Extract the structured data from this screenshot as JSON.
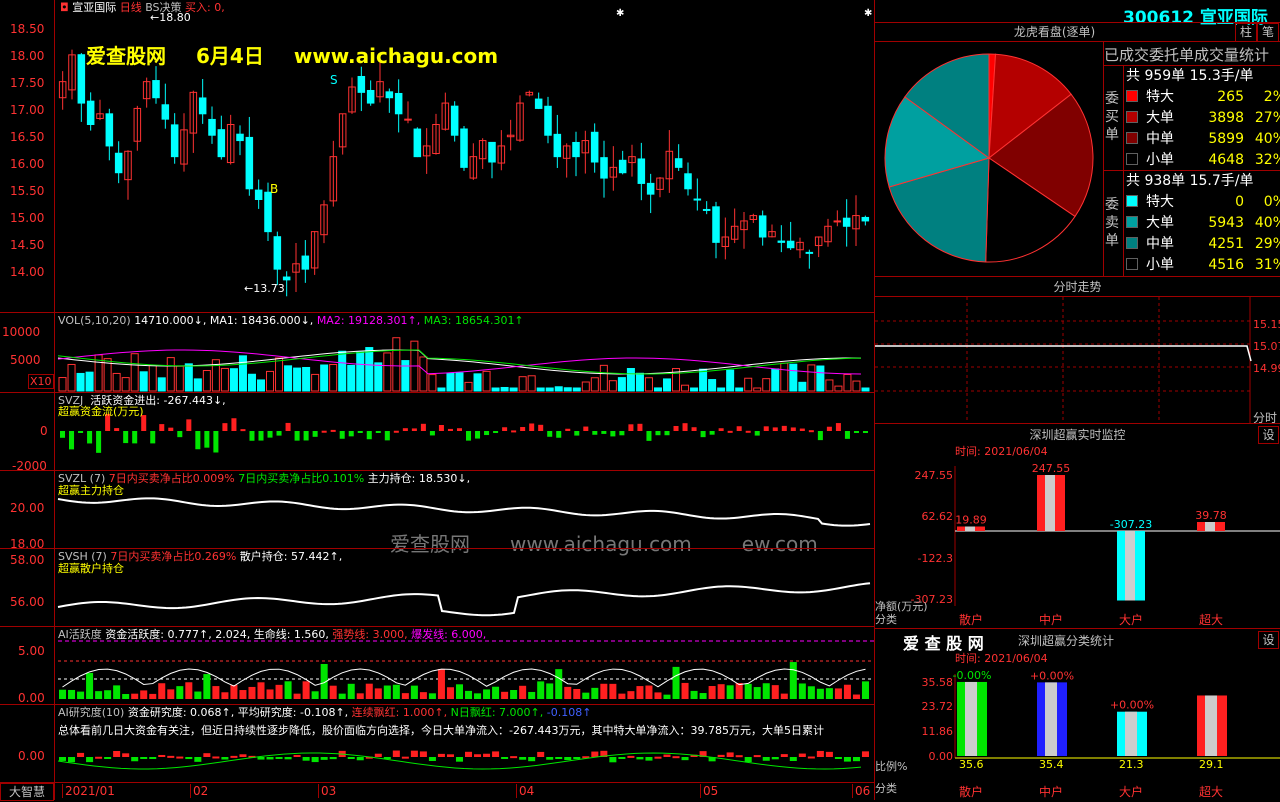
{
  "app": {
    "name": "大智慧",
    "brand_overlay": "爱查股网",
    "date_overlay": "6月4日",
    "url_overlay": "www.aichagu.com"
  },
  "main_chart": {
    "stock_name": "宣亚国际",
    "period": "日线",
    "strategy": "BS决策",
    "buy_text": "买入: 0,",
    "high_marker": "18.80",
    "low_marker": "13.73",
    "b_marker": "B",
    "s_marker": "S",
    "price_ticks": [
      "18.50",
      "18.00",
      "17.50",
      "17.00",
      "16.50",
      "16.00",
      "15.50",
      "15.00",
      "14.50",
      "14.00"
    ]
  },
  "vol_panel": {
    "label": "VOL(5,10,20)",
    "value": "14710.000↓,",
    "ma1": "MA1: 18436.000↓,",
    "ma2": "MA2: 19128.301↑,",
    "ma3": "MA3: 18654.301↑",
    "ticks": [
      "10000",
      "5000"
    ],
    "unit": "X10"
  },
  "svzj_panel": {
    "label": "SVZJ",
    "desc": "活跃资金进出: -267.443↓,",
    "sub": "超赢资金流(万元)",
    "ticks": [
      "0",
      "-2000"
    ]
  },
  "svzl_panel": {
    "label": "SVZL (7)",
    "a": "7日内买卖净占比0.009%",
    "b": "7日内买卖净占比0.101%",
    "c": "主力持仓: 18.530↓,",
    "sub": "超赢主力持仓",
    "ticks": [
      "20.00",
      "18.00"
    ],
    "watermark1": "爱查股网",
    "watermark2": "www.aichagu.com",
    "watermark3": "ew.com"
  },
  "svsh_panel": {
    "label": "SVSH (7)",
    "a": "7日内买卖净占比0.269%",
    "b": "散户持仓: 57.442↑,",
    "sub": "超赢散户持仓",
    "ticks": [
      "58.00",
      "56.00"
    ]
  },
  "ai_active": {
    "label": "AI活跃度",
    "a": "资金活跃度: 0.777↑,",
    "b": "2.024,",
    "c": "生命线: 1.560,",
    "d": "强势线: 3.000,",
    "e": "爆发线: 6.000,",
    "ticks": [
      "5.00",
      "0.00"
    ]
  },
  "ai_research": {
    "label": "AI研究度(10)",
    "a": "资金研究度: 0.068↑,",
    "b": "平均研究度: -0.108↑,",
    "c": "连续飘红: 1.000↑,",
    "d": "N日飘红: 7.000↑,",
    "e": "-0.108↑",
    "summary": "总体看前几日大资金有关注，但近日持续性逐步降低，股价面临方向选择，今日大单净流入：-267.443万元，其中特大单净流入：39.785万元，大单5日累计",
    "tick": "0.00"
  },
  "x_axis": [
    "2021/01",
    "02",
    "03",
    "04",
    "05",
    "06"
  ],
  "right": {
    "code": "300612",
    "name": "宣亚国际",
    "tab1": "柱",
    "tab2": "笔",
    "pie_title": "龙虎看盘(逐单)",
    "stats_title": "已成交委托单成交量统计",
    "buy_header": "共 959单 15.3手/单",
    "buy_label": "委买单",
    "buy_rows": [
      {
        "name": "特大",
        "count": "265",
        "pct": "2%",
        "color": "#ff0000"
      },
      {
        "name": "大单",
        "count": "3898",
        "pct": "27%",
        "color": "#b40000"
      },
      {
        "name": "中单",
        "count": "5899",
        "pct": "40%",
        "color": "#800000"
      },
      {
        "name": "小单",
        "count": "4648",
        "pct": "32%",
        "color": "#000000"
      }
    ],
    "sell_header": "共 938单 15.7手/单",
    "sell_label": "委卖单",
    "sell_rows": [
      {
        "name": "特大",
        "count": "0",
        "pct": "0%",
        "color": "#00ffff"
      },
      {
        "name": "大单",
        "count": "5943",
        "pct": "40%",
        "color": "#00a0a0"
      },
      {
        "name": "中单",
        "count": "4251",
        "pct": "29%",
        "color": "#008080"
      },
      {
        "name": "小单",
        "count": "4516",
        "pct": "31%",
        "color": "#000000"
      }
    ],
    "tick_title": "分时走势",
    "tick_prices": [
      "15.15",
      "15.07",
      "14.99"
    ],
    "tick_unit": "分时",
    "monitor_title": "深圳超赢实时监控",
    "monitor_btn": "设",
    "monitor_time": "时间: 2021/06/04",
    "monitor_ticks": [
      "247.55",
      "62.62",
      "-122.3",
      "-307.23"
    ],
    "monitor_ylabel": "净额(万元)",
    "monitor_xlabel": "分类",
    "monitor_values": [
      "19.89",
      "247.55",
      "-307.23",
      "39.78"
    ],
    "categories": [
      "散户",
      "中户",
      "大户",
      "超大"
    ],
    "stats_brand": "爱 查 股 网",
    "stats_title2": "深圳超赢分类统计",
    "stats_btn": "设",
    "stats_time": "时间: 2021/06/04",
    "stats_ticks": [
      "35.58",
      "23.72",
      "11.86",
      "0.00"
    ],
    "stats_ylabel": "比例%",
    "stats_xlabel": "分类",
    "stats_top": [
      "-0.00%",
      "+0.00%",
      "+0.00%",
      ""
    ],
    "stats_values": [
      "35.6",
      "35.4",
      "21.3",
      "29.1"
    ]
  }
}
